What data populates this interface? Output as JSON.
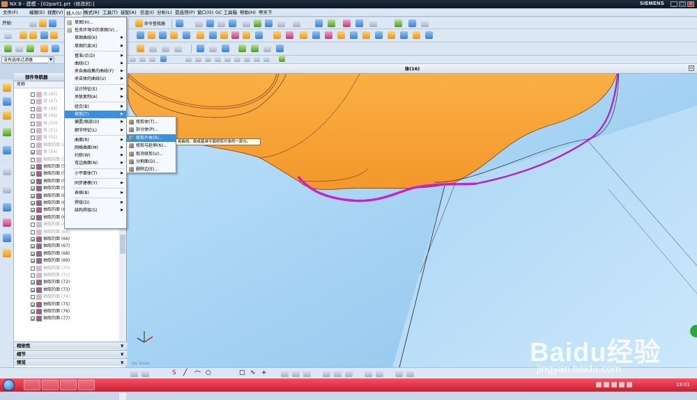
{
  "window": {
    "title": "NX 8 - 建模 - [02part1.prt（修改的）]",
    "brand": "SIEMENS",
    "min": "_",
    "max": "□",
    "close": "×"
  },
  "menubar": [
    {
      "label": "文件(F)",
      "id": "file"
    },
    {
      "label": "编辑(E)",
      "id": "edit"
    },
    {
      "label": "视图(V)",
      "id": "view"
    },
    {
      "label": "插入(S)",
      "id": "insert"
    },
    {
      "label": "格式(R)",
      "id": "format"
    },
    {
      "label": "工具(T)",
      "id": "tools"
    },
    {
      "label": "装配(A)",
      "id": "assembly"
    },
    {
      "label": "信息(I)",
      "id": "info"
    },
    {
      "label": "分析(L)",
      "id": "analysis"
    },
    {
      "label": "首选项(P)",
      "id": "prefs"
    },
    {
      "label": "窗口(O)",
      "id": "window"
    },
    {
      "label": "GC 工具箱",
      "id": "gc"
    },
    {
      "label": "帮助(H)",
      "id": "help"
    },
    {
      "label": "甲天下",
      "id": "jtx"
    }
  ],
  "toolbar": {
    "start_label": "开始·",
    "command_finder": "命令查找器"
  },
  "selection": {
    "filter_value": "没有选择过滤器",
    "dropdown": "▼"
  },
  "viewport": {
    "title": "体(16)",
    "scene_label": "Pie Sheet"
  },
  "navigator": {
    "title": "部件导航器",
    "column": "名称",
    "rows": [
      {
        "label": "体 (45)",
        "checked": false,
        "dim": true
      },
      {
        "label": "体 (47)",
        "checked": false,
        "dim": true
      },
      {
        "label": "体 (48)",
        "checked": false,
        "dim": true
      },
      {
        "label": "体 (49)",
        "checked": false,
        "dim": true
      },
      {
        "label": "体 (50)",
        "checked": false,
        "dim": true
      },
      {
        "label": "体 (51)",
        "checked": false,
        "dim": true
      },
      {
        "label": "体 (52)",
        "checked": false,
        "dim": true
      },
      {
        "label": "抽取的面 (53)",
        "checked": false,
        "dim": true
      },
      {
        "label": "体 (54)",
        "checked": true,
        "dim": true
      },
      {
        "label": "抽取的面 (55)",
        "checked": false,
        "dim": true
      },
      {
        "label": "抽取的面 (56)",
        "checked": true,
        "dim": false
      },
      {
        "label": "抽取的面 (57)",
        "checked": true,
        "dim": false
      },
      {
        "label": "抽取的面 (58)",
        "checked": true,
        "dim": false
      },
      {
        "label": "抽取的面 (59)",
        "checked": true,
        "dim": false
      },
      {
        "label": "抽取的面 (60)",
        "checked": true,
        "dim": false
      },
      {
        "label": "抽取的面 (61)",
        "checked": true,
        "dim": false
      },
      {
        "label": "抽取的面 (62)",
        "checked": true,
        "dim": false
      },
      {
        "label": "抽取的面 (63)",
        "checked": true,
        "dim": false
      },
      {
        "label": "抽取的面 (64)",
        "checked": false,
        "dim": true
      },
      {
        "label": "抽取的面 (65)",
        "checked": false,
        "dim": true
      },
      {
        "label": "抽取的面 (66)",
        "checked": true,
        "dim": false
      },
      {
        "label": "抽取的面 (67)",
        "checked": true,
        "dim": false
      },
      {
        "label": "抽取的面 (68)",
        "checked": true,
        "dim": false
      },
      {
        "label": "抽取的面 (69)",
        "checked": true,
        "dim": false
      },
      {
        "label": "抽取的面 (70)",
        "checked": false,
        "dim": true
      },
      {
        "label": "抽取的面 (71)",
        "checked": false,
        "dim": true
      },
      {
        "label": "抽取的面 (72)",
        "checked": true,
        "dim": false
      },
      {
        "label": "抽取的面 (73)",
        "checked": true,
        "dim": false
      },
      {
        "label": "抽取的面 (74)",
        "checked": false,
        "dim": true
      },
      {
        "label": "抽取的面 (75)",
        "checked": true,
        "dim": false
      },
      {
        "label": "抽取的面 (76)",
        "checked": true,
        "dim": false
      },
      {
        "label": "抽取的面 (77)",
        "checked": true,
        "dim": false
      }
    ],
    "panes": [
      "相依性",
      "细节",
      "预览"
    ]
  },
  "insert_menu": {
    "items": [
      {
        "label": "草图(H)...",
        "arrow": false,
        "icon": true
      },
      {
        "label": "任务环境中的草图(V)...",
        "arrow": false,
        "icon": true
      },
      {
        "label": "草图曲线(K)",
        "arrow": true,
        "icon": false
      },
      {
        "label": "草图约束(K)",
        "arrow": true,
        "icon": false
      },
      {
        "label": "基准/点(D)",
        "arrow": true,
        "icon": false,
        "sep_before": true
      },
      {
        "label": "曲线(C)",
        "arrow": true,
        "icon": false
      },
      {
        "label": "来自曲线集的曲线(F)",
        "arrow": true,
        "icon": false
      },
      {
        "label": "来自体的曲线(U)",
        "arrow": true,
        "icon": false
      },
      {
        "label": "设计特征(E)",
        "arrow": true,
        "icon": false,
        "sep_before": true
      },
      {
        "label": "关联复制(A)",
        "arrow": true,
        "icon": false
      },
      {
        "label": "组合(B)",
        "arrow": true,
        "icon": false,
        "sep_before": true
      },
      {
        "label": "修剪(T)",
        "arrow": true,
        "icon": false,
        "highlight": true
      },
      {
        "label": "偏置/缩放(O)",
        "arrow": true,
        "icon": false
      },
      {
        "label": "细节特征(L)",
        "arrow": true,
        "icon": false
      },
      {
        "label": "曲面(R)",
        "arrow": true,
        "icon": false,
        "sep_before": true
      },
      {
        "label": "网格曲面(M)",
        "arrow": true,
        "icon": false
      },
      {
        "label": "扫掠(W)",
        "arrow": true,
        "icon": false
      },
      {
        "label": "弯边曲面(N)",
        "arrow": true,
        "icon": false
      },
      {
        "label": "小平面体(T)",
        "arrow": true,
        "icon": false,
        "sep_before": true
      },
      {
        "label": "同步建模(Y)",
        "arrow": true,
        "icon": false,
        "sep_before": true
      },
      {
        "label": "表格(B)",
        "arrow": true,
        "icon": false,
        "sep_before": true
      },
      {
        "label": "焊接(D)",
        "arrow": true,
        "icon": false,
        "sep_before": true
      },
      {
        "label": "结构焊接(S)",
        "arrow": true,
        "icon": false
      }
    ]
  },
  "trim_submenu": {
    "items": [
      {
        "label": "修剪体(T)...",
        "highlight": false
      },
      {
        "label": "拆分体(P)...",
        "highlight": false
      },
      {
        "label": "修剪片体(R)...",
        "highlight": true
      },
      {
        "label": "修剪与延伸(N)...",
        "highlight": false
      },
      {
        "label": "取消修剪(U)...",
        "highlight": false
      },
      {
        "label": "分割面(D)...",
        "highlight": false
      },
      {
        "label": "删除边(E)...",
        "highlight": false
      }
    ]
  },
  "tooltip": "用曲线、面或基准平面修剪片体的一部分。",
  "watermark": {
    "brand": "Baidu经验",
    "url": "jingyan.baidu.com"
  },
  "taskbar": {
    "time": "19:01"
  },
  "colors": {
    "accent": "#3b8fe0",
    "part": "#f7a43a",
    "part_edge": "#b45a12",
    "bg_surface": "#9dcdf2",
    "trim_edge": "#c81ed8",
    "taskbar": "#d62a3c"
  }
}
